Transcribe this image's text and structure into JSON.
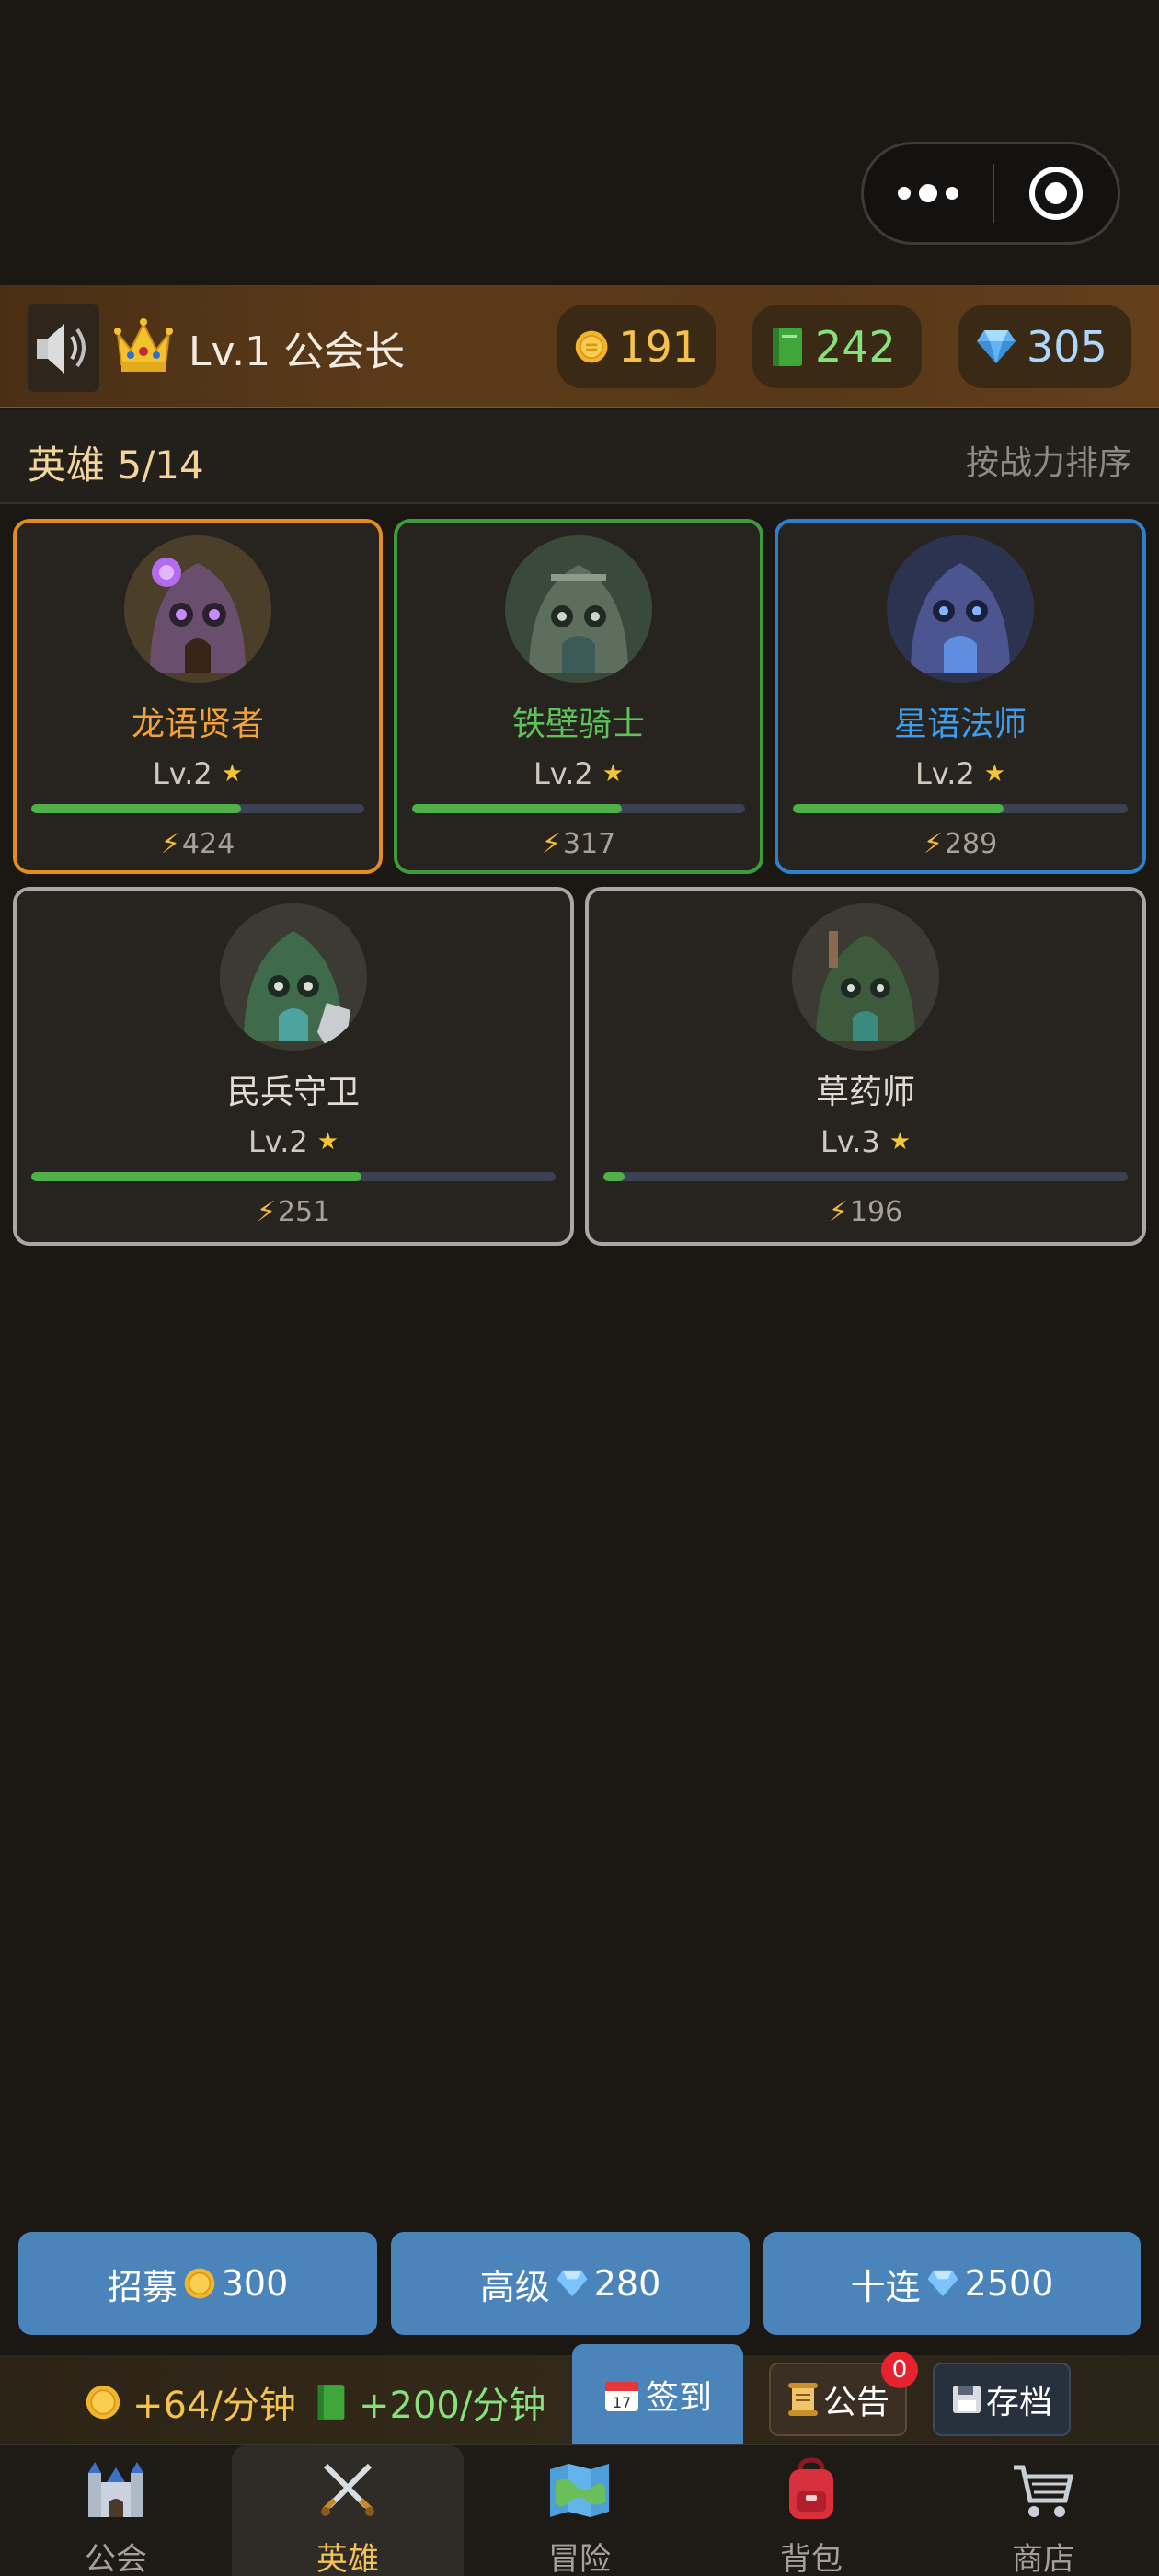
{
  "header": {
    "rank_text": "Lv.1 公会长",
    "gold": "191",
    "books": "242",
    "gems": "305"
  },
  "section": {
    "title": "英雄 5/14",
    "sort_label": "按战力排序"
  },
  "heroes": [
    {
      "name": "龙语贤者",
      "level": "Lv.2",
      "power": "424",
      "xp_fraction": 0.63,
      "rarity_color": "#e38d1f"
    },
    {
      "name": "铁壁骑士",
      "level": "Lv.2",
      "power": "317",
      "xp_fraction": 0.63,
      "rarity_color": "#3e9a3c"
    },
    {
      "name": "星语法师",
      "level": "Lv.2",
      "power": "289",
      "xp_fraction": 0.63,
      "rarity_color": "#2d7fd0"
    },
    {
      "name": "民兵守卫",
      "level": "Lv.2",
      "power": "251",
      "xp_fraction": 0.63,
      "rarity_color": "#a8a8a8"
    },
    {
      "name": "草药师",
      "level": "Lv.3",
      "power": "196",
      "xp_fraction": 0.04,
      "rarity_color": "#a8a8a8"
    }
  ],
  "recruit": {
    "normal_label": "招募",
    "normal_cost": "300",
    "advanced_label": "高级",
    "advanced_cost": "280",
    "ten_label": "十连",
    "ten_cost": "2500"
  },
  "income": {
    "gold": "+64/分钟",
    "books": "+200/分钟"
  },
  "actions": {
    "checkin": "签到",
    "checkin_icon_day": "17",
    "notice": "公告",
    "notice_badge": "0",
    "save": "存档"
  },
  "nav": [
    {
      "label": "公会",
      "icon": "castle-icon"
    },
    {
      "label": "英雄",
      "icon": "crossed-swords-icon"
    },
    {
      "label": "冒险",
      "icon": "map-icon"
    },
    {
      "label": "背包",
      "icon": "backpack-icon"
    },
    {
      "label": "商店",
      "icon": "shopping-cart-icon"
    }
  ],
  "active_nav": "英雄"
}
